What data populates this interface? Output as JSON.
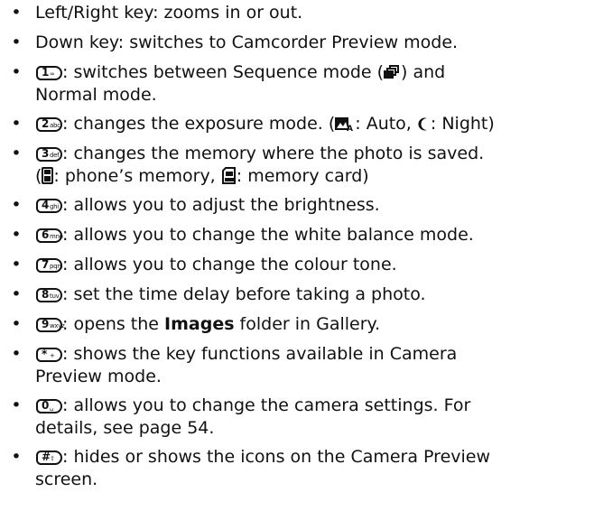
{
  "items": [
    {
      "pre": "",
      "key": null,
      "text": "Left/Right key: zooms in or out."
    },
    {
      "pre": "",
      "key": null,
      "text": "Down key: switches to Camcorder Preview mode."
    },
    {
      "key": {
        "d": "1",
        "s": "∞"
      },
      "parts": [
        ": switches between Sequence mode (",
        ") and"
      ],
      "line2": "Normal mode."
    },
    {
      "key": {
        "d": "2",
        "s": "abc"
      },
      "parts": [
        ": changes the exposure mode. (",
        ": Auto, ",
        ": Night)"
      ]
    },
    {
      "key": {
        "d": "3",
        "s": "def"
      },
      "text": ": changes the memory where the photo is saved.",
      "line2parts": [
        "(",
        ": phone’s memory, ",
        ": memory card)"
      ]
    },
    {
      "key": {
        "d": "4",
        "s": "ghi"
      },
      "text": ": allows you to adjust the brightness."
    },
    {
      "key": {
        "d": "6",
        "s": "mno"
      },
      "text": ": allows you to change the white balance mode."
    },
    {
      "key": {
        "d": "7",
        "s": "pqrs"
      },
      "text": ": allows you to change the colour tone."
    },
    {
      "key": {
        "d": "8",
        "s": "tuv"
      },
      "text": ": set the time delay before taking a photo."
    },
    {
      "key": {
        "d": "9",
        "s": "wxyz"
      },
      "parts": [
        ": opens the ",
        "Images",
        " folder in Gallery."
      ]
    },
    {
      "key": {
        "d": "*",
        "s": "+"
      },
      "text": ": shows the key functions available in Camera",
      "line2": "Preview mode."
    },
    {
      "key": {
        "d": "0",
        "s": "␣"
      },
      "text": ": allows you to change the camera settings. For",
      "line2": "details, see page 54."
    },
    {
      "key": {
        "d": "#",
        "s": "⇧"
      },
      "text": ": hides or shows the icons on the Camera Preview",
      "line2": "screen."
    }
  ],
  "bullet": "•"
}
